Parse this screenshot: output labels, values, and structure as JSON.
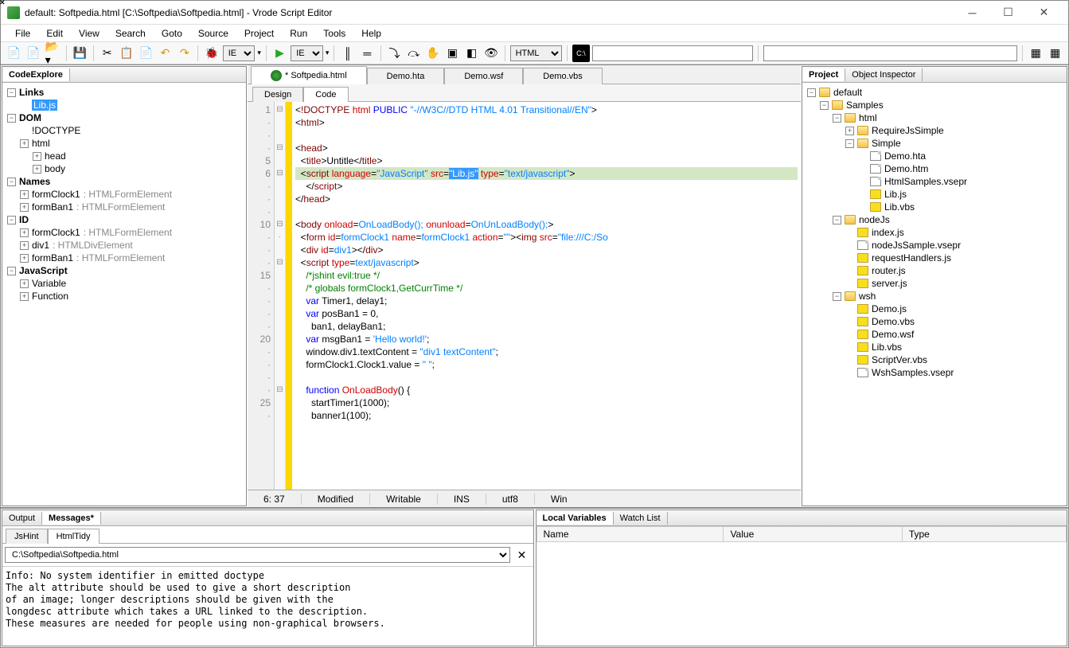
{
  "title": "default: Softpedia.html [C:\\Softpedia\\Softpedia.html] - Vrode Script Editor",
  "menu": [
    "File",
    "Edit",
    "View",
    "Search",
    "Goto",
    "Source",
    "Project",
    "Run",
    "Tools",
    "Help"
  ],
  "toolbar": {
    "browser": "IE",
    "runbrowser": "IE",
    "lang": "HTML"
  },
  "codeexplore": {
    "title": "CodeExplore",
    "sections": [
      {
        "label": "Links",
        "bold": true,
        "children": [
          {
            "label": "Lib.js",
            "selected": true
          }
        ]
      },
      {
        "label": "DOM",
        "bold": true,
        "children": [
          {
            "label": "!DOCTYPE"
          },
          {
            "label": "html",
            "expandable": true,
            "children": [
              {
                "label": "head",
                "expandable": true
              },
              {
                "label": "body",
                "expandable": true
              }
            ]
          }
        ]
      },
      {
        "label": "Names",
        "bold": true,
        "children": [
          {
            "label": "formClock1",
            "type": ": HTMLFormElement",
            "expandable": true
          },
          {
            "label": "formBan1",
            "type": ": HTMLFormElement",
            "expandable": true
          }
        ]
      },
      {
        "label": "ID",
        "bold": true,
        "children": [
          {
            "label": "formClock1",
            "type": ": HTMLFormElement",
            "expandable": true
          },
          {
            "label": "div1",
            "type": ": HTMLDivElement",
            "expandable": true
          },
          {
            "label": "formBan1",
            "type": ": HTMLFormElement",
            "expandable": true
          }
        ]
      },
      {
        "label": "JavaScript",
        "bold": true,
        "children": [
          {
            "label": "Variable",
            "expandable": true
          },
          {
            "label": "Function",
            "expandable": true
          }
        ]
      }
    ]
  },
  "filetabs": [
    {
      "label": "* Softpedia.html",
      "active": true,
      "hasbug": true
    },
    {
      "label": "Demo.hta"
    },
    {
      "label": "Demo.wsf"
    },
    {
      "label": "Demo.vbs"
    }
  ],
  "subtabs": [
    {
      "label": "Design"
    },
    {
      "label": "Code",
      "active": true
    }
  ],
  "status": {
    "pos": "6: 37",
    "mod": "Modified",
    "wr": "Writable",
    "ins": "INS",
    "enc": "utf8",
    "os": "Win"
  },
  "project": {
    "tabs": [
      "Project",
      "Object Inspector"
    ],
    "root": "default",
    "folders": [
      {
        "name": "Samples",
        "children": [
          {
            "name": "html",
            "children": [
              {
                "name": "RequireJsSimple",
                "type": "folder",
                "closed": true
              },
              {
                "name": "Simple",
                "type": "folder",
                "children": [
                  {
                    "name": "Demo.hta"
                  },
                  {
                    "name": "Demo.htm"
                  },
                  {
                    "name": "HtmlSamples.vsepr"
                  },
                  {
                    "name": "Lib.js",
                    "js": true
                  },
                  {
                    "name": "Lib.vbs",
                    "js": true
                  }
                ]
              }
            ]
          },
          {
            "name": "nodeJs",
            "children": [
              {
                "name": "index.js",
                "js": true
              },
              {
                "name": "nodeJsSample.vsepr"
              },
              {
                "name": "requestHandlers.js",
                "js": true
              },
              {
                "name": "router.js",
                "js": true
              },
              {
                "name": "server.js",
                "js": true
              }
            ]
          },
          {
            "name": "wsh",
            "children": [
              {
                "name": "Demo.js",
                "js": true
              },
              {
                "name": "Demo.vbs",
                "js": true
              },
              {
                "name": "Demo.wsf",
                "js": true
              },
              {
                "name": "Lib.vbs",
                "js": true
              },
              {
                "name": "ScriptVer.vbs",
                "js": true
              },
              {
                "name": "WshSamples.vsepr"
              }
            ]
          }
        ]
      }
    ]
  },
  "output": {
    "tabs": [
      "Output",
      "Messages*"
    ],
    "subtabs": [
      "JsHint",
      "HtmlTidy"
    ],
    "path": "C:\\Softpedia\\Softpedia.html",
    "text": "Info: No system identifier in emitted doctype\nThe alt attribute should be used to give a short description\nof an image; longer descriptions should be given with the\nlongdesc attribute which takes a URL linked to the description.\nThese measures are needed for people using non-graphical browsers."
  },
  "watch": {
    "tabs": [
      "Local Variables",
      "Watch List"
    ],
    "cols": [
      "Name",
      "Value",
      "Type"
    ]
  },
  "code_lines": [
    1,
    "",
    "",
    "",
    5,
    6,
    "",
    "",
    "",
    10,
    "",
    "",
    "",
    15,
    "",
    "",
    "",
    "",
    20,
    "",
    "",
    "",
    "",
    25,
    ""
  ]
}
